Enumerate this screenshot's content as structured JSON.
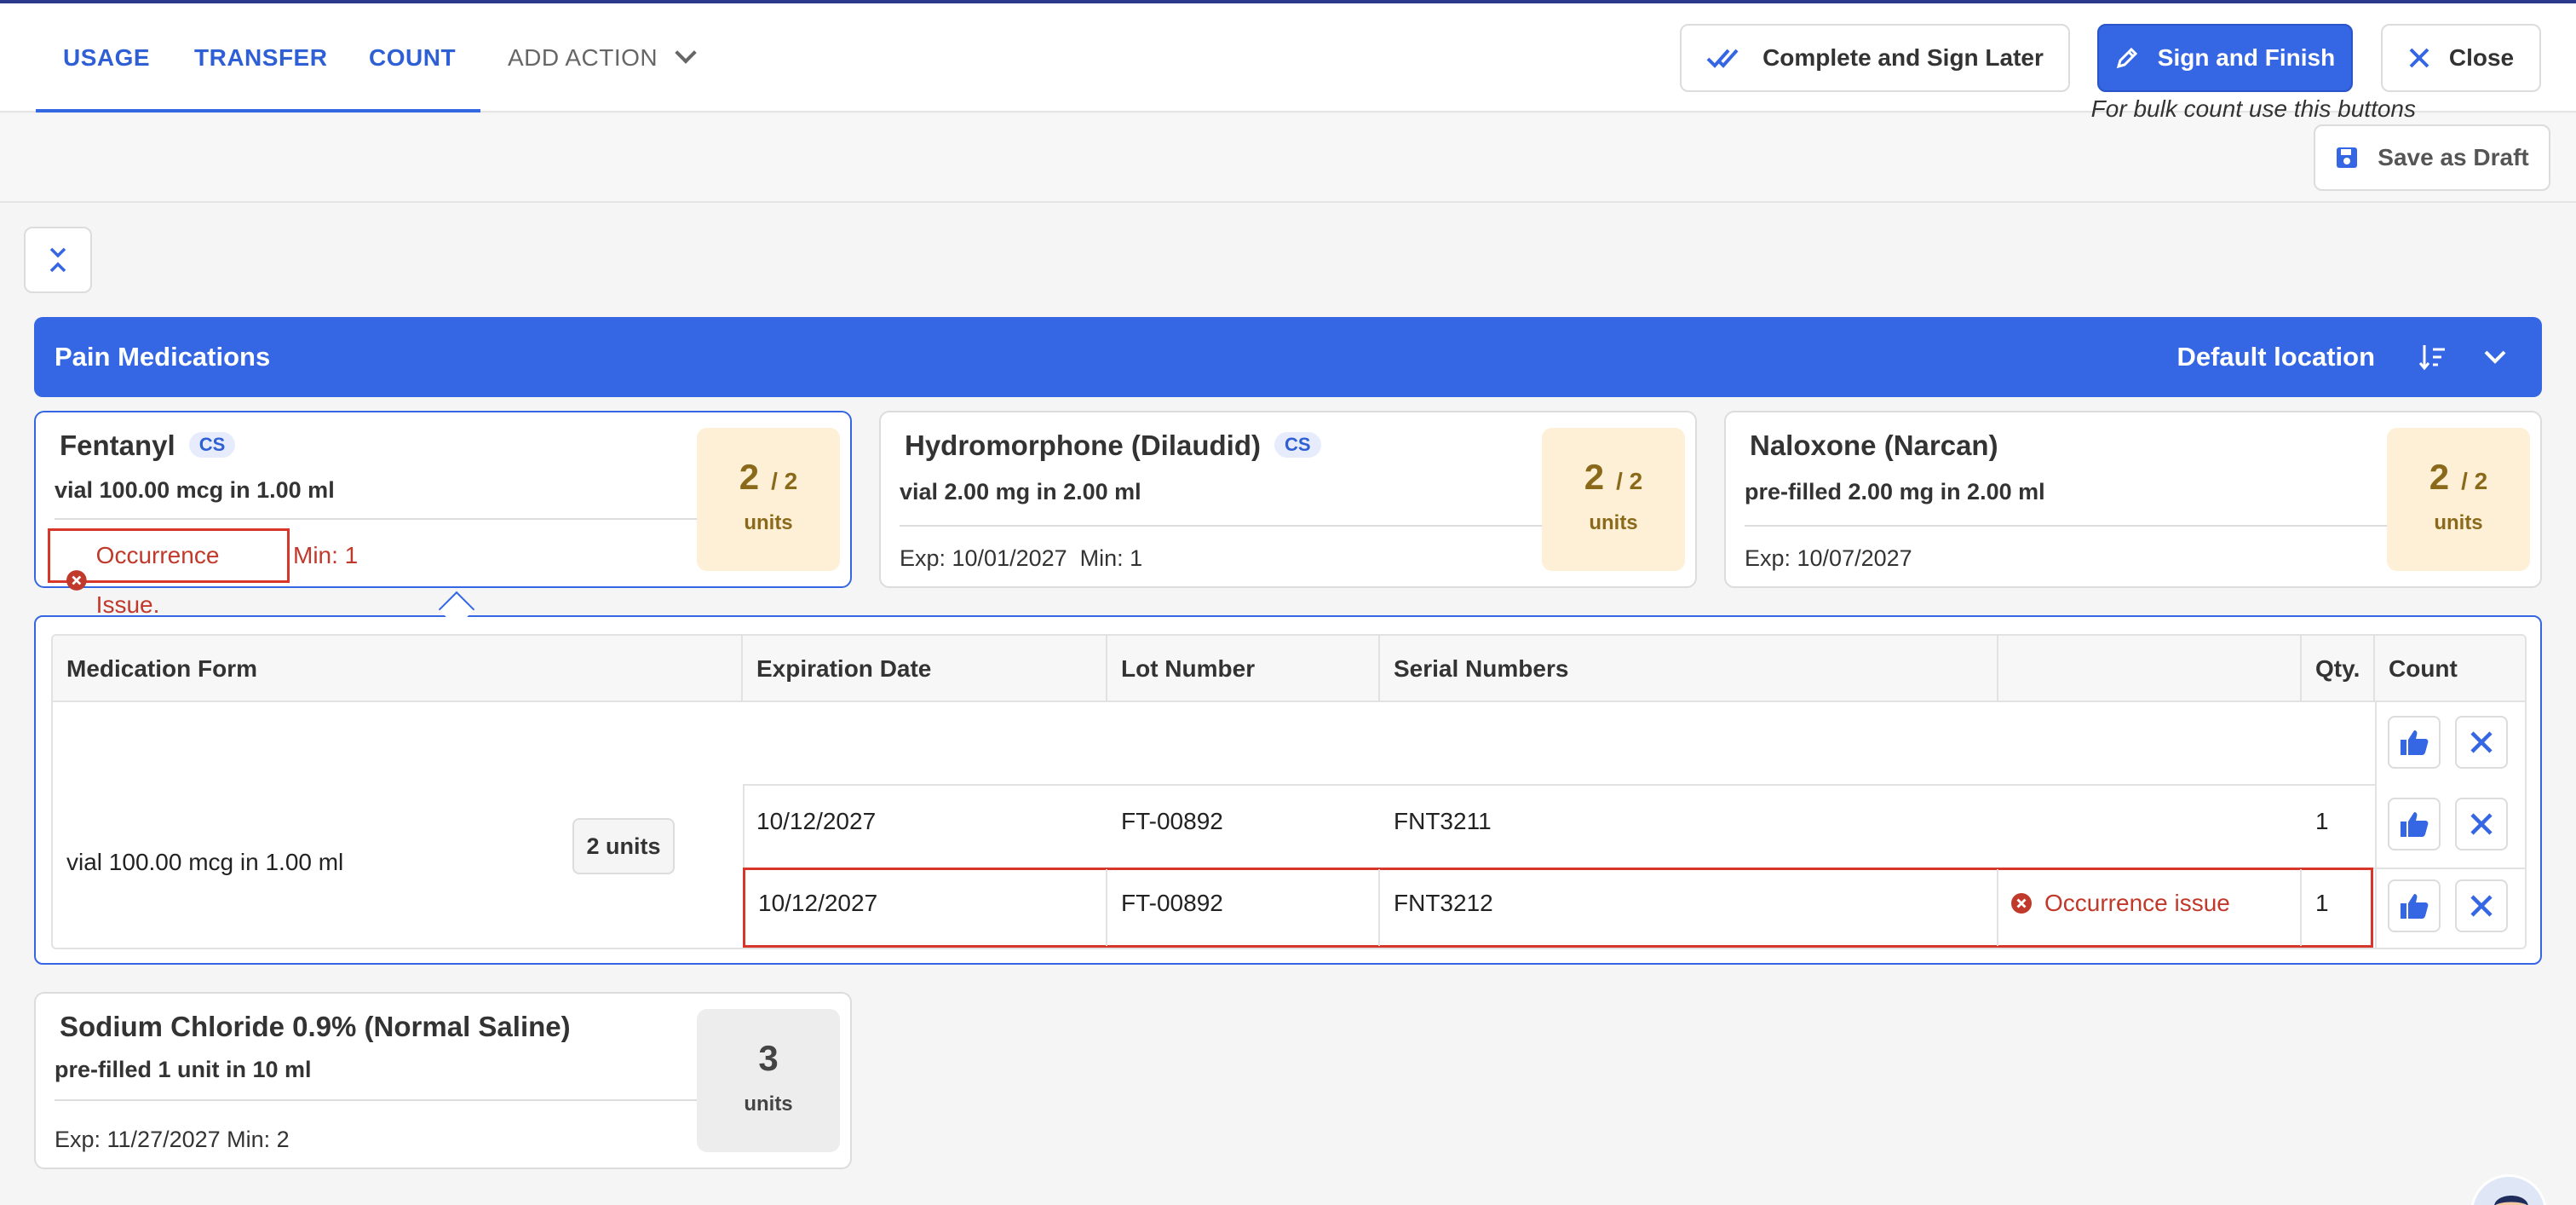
{
  "header": {
    "tabs": [
      {
        "label": "USAGE"
      },
      {
        "label": "TRANSFER"
      },
      {
        "label": "COUNT"
      }
    ],
    "add_action_label": "ADD ACTION",
    "complete_later_label": "Complete and Sign Later",
    "sign_finish_label": "Sign and Finish",
    "close_label": "Close",
    "save_draft_label": "Save as Draft"
  },
  "section": {
    "title": "Pain Medications",
    "location": "Default location"
  },
  "cards": [
    {
      "name": "Fentanyl",
      "badge": "CS",
      "form": "vial 100.00 mcg in 1.00 ml",
      "occurrence": "Occurrence Issue.",
      "min": "Min: 1",
      "qty": "2",
      "qty_total": "/ 2",
      "unit": "units"
    },
    {
      "name": "Hydromorphone (Dilaudid)",
      "badge": "CS",
      "form": "vial 2.00 mg in 2.00 ml",
      "meta": "Exp: 10/01/2027  Min: 1",
      "qty": "2",
      "qty_total": "/ 2",
      "unit": "units"
    },
    {
      "name": "Naloxone (Narcan)",
      "form": "pre-filled 2.00 mg in 2.00 ml",
      "meta": "Exp: 10/07/2027",
      "qty": "2",
      "qty_total": "/ 2",
      "unit": "units"
    },
    {
      "name": "Sodium Chloride 0.9% (Normal Saline)",
      "form": "pre-filled 1 unit in 10 ml",
      "meta": "Exp: 11/27/2027 Min: 2",
      "qty": "3",
      "unit": "units"
    }
  ],
  "table": {
    "headers": [
      "Medication Form",
      "Expiration Date",
      "Lot Number",
      "Serial Numbers",
      "",
      "Qty.",
      "Count"
    ],
    "bulk_text": "For bulk count use this buttons",
    "form": "vial 100.00 mcg in 1.00 ml",
    "units": "2 units",
    "rows": [
      {
        "exp": "10/12/2027",
        "lot": "FT-00892",
        "serial": "FNT3211",
        "issue": "",
        "qty": "1"
      },
      {
        "exp": "10/12/2027",
        "lot": "FT-00892",
        "serial": "FNT3212",
        "issue": "Occurrence issue",
        "qty": "1"
      }
    ]
  },
  "colors": {
    "primary": "#3566e3",
    "error": "#c0392b",
    "qty_bg": "#fdf0d7"
  }
}
